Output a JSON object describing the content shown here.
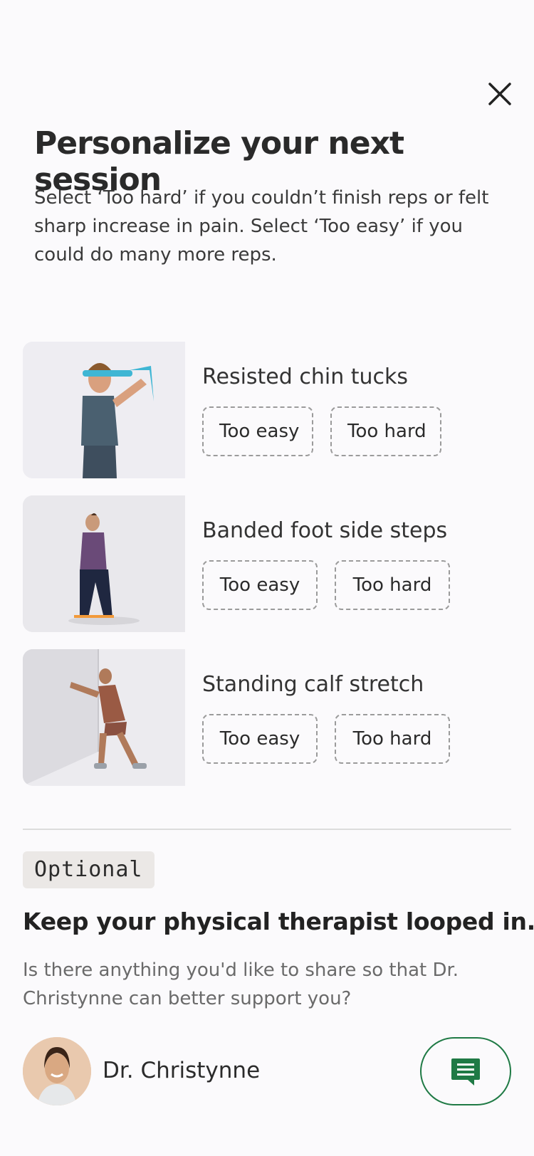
{
  "header": {
    "title": "Personalize your next session",
    "subtitle": "Select ‘Too hard’ if you couldn’t finish reps or felt sharp increase in pain. Select ‘Too easy’ if you could do many more reps."
  },
  "exercises": [
    {
      "name": "Resisted chin tucks",
      "easy_label": "Too easy",
      "hard_label": "Too hard"
    },
    {
      "name": "Banded foot side steps",
      "easy_label": "Too easy",
      "hard_label": "Too hard"
    },
    {
      "name": "Standing calf stretch",
      "easy_label": "Too easy",
      "hard_label": "Too hard"
    }
  ],
  "feedback": {
    "optional_label": "Optional",
    "title": "Keep your physical therapist looped in.",
    "prompt": "Is there anything you'd like to share so that Dr. Christynne can better support you?"
  },
  "therapist": {
    "name": "Dr. Christynne"
  },
  "icons": {
    "close": "close-icon",
    "chat": "chat-icon"
  },
  "colors": {
    "accent": "#1f7a45",
    "background": "#fbfafc"
  }
}
